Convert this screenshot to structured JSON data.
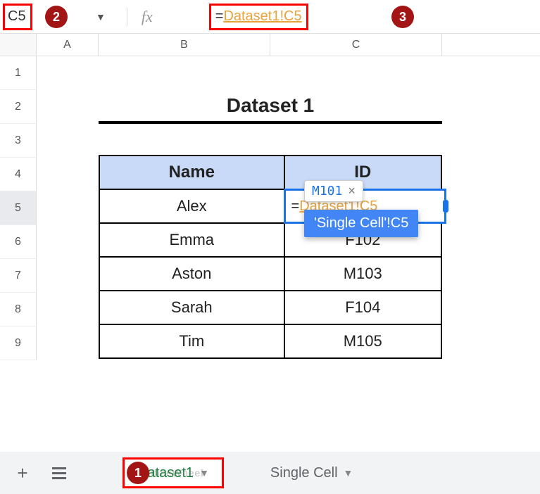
{
  "formula_bar": {
    "cell_ref": "C5",
    "fx_label": "fx",
    "formula_prefix": "=",
    "formula_link": "Dataset1!C5"
  },
  "annotations": {
    "badge1": "1",
    "badge2": "2",
    "badge3": "3"
  },
  "columns": [
    "A",
    "B",
    "C"
  ],
  "rows": [
    "1",
    "2",
    "3",
    "4",
    "5",
    "6",
    "7",
    "8",
    "9"
  ],
  "dataset": {
    "title": "Dataset 1",
    "headers": {
      "name": "Name",
      "id": "ID"
    },
    "rows": [
      {
        "name": "Alex",
        "id_editing": true
      },
      {
        "name": "Emma",
        "id": "F102"
      },
      {
        "name": "Aston",
        "id": "M103"
      },
      {
        "name": "Sarah",
        "id": "F104"
      },
      {
        "name": "Tim",
        "id": "M105"
      }
    ]
  },
  "cell_editor": {
    "prefix": "=",
    "link": "Dataset1!C5"
  },
  "hint": {
    "value": "M101",
    "close": "×"
  },
  "tooltip": "'Single Cell'!C5",
  "tabs": {
    "add": "+",
    "active": "Dataset1",
    "other": "Single Cell"
  },
  "watermark": "OfficeWheel",
  "chart_data": {
    "type": "table",
    "title": "Dataset 1",
    "columns": [
      "Name",
      "ID"
    ],
    "rows": [
      [
        "Alex",
        "M101"
      ],
      [
        "Emma",
        "F102"
      ],
      [
        "Aston",
        "M103"
      ],
      [
        "Sarah",
        "F104"
      ],
      [
        "Tim",
        "M105"
      ]
    ]
  }
}
